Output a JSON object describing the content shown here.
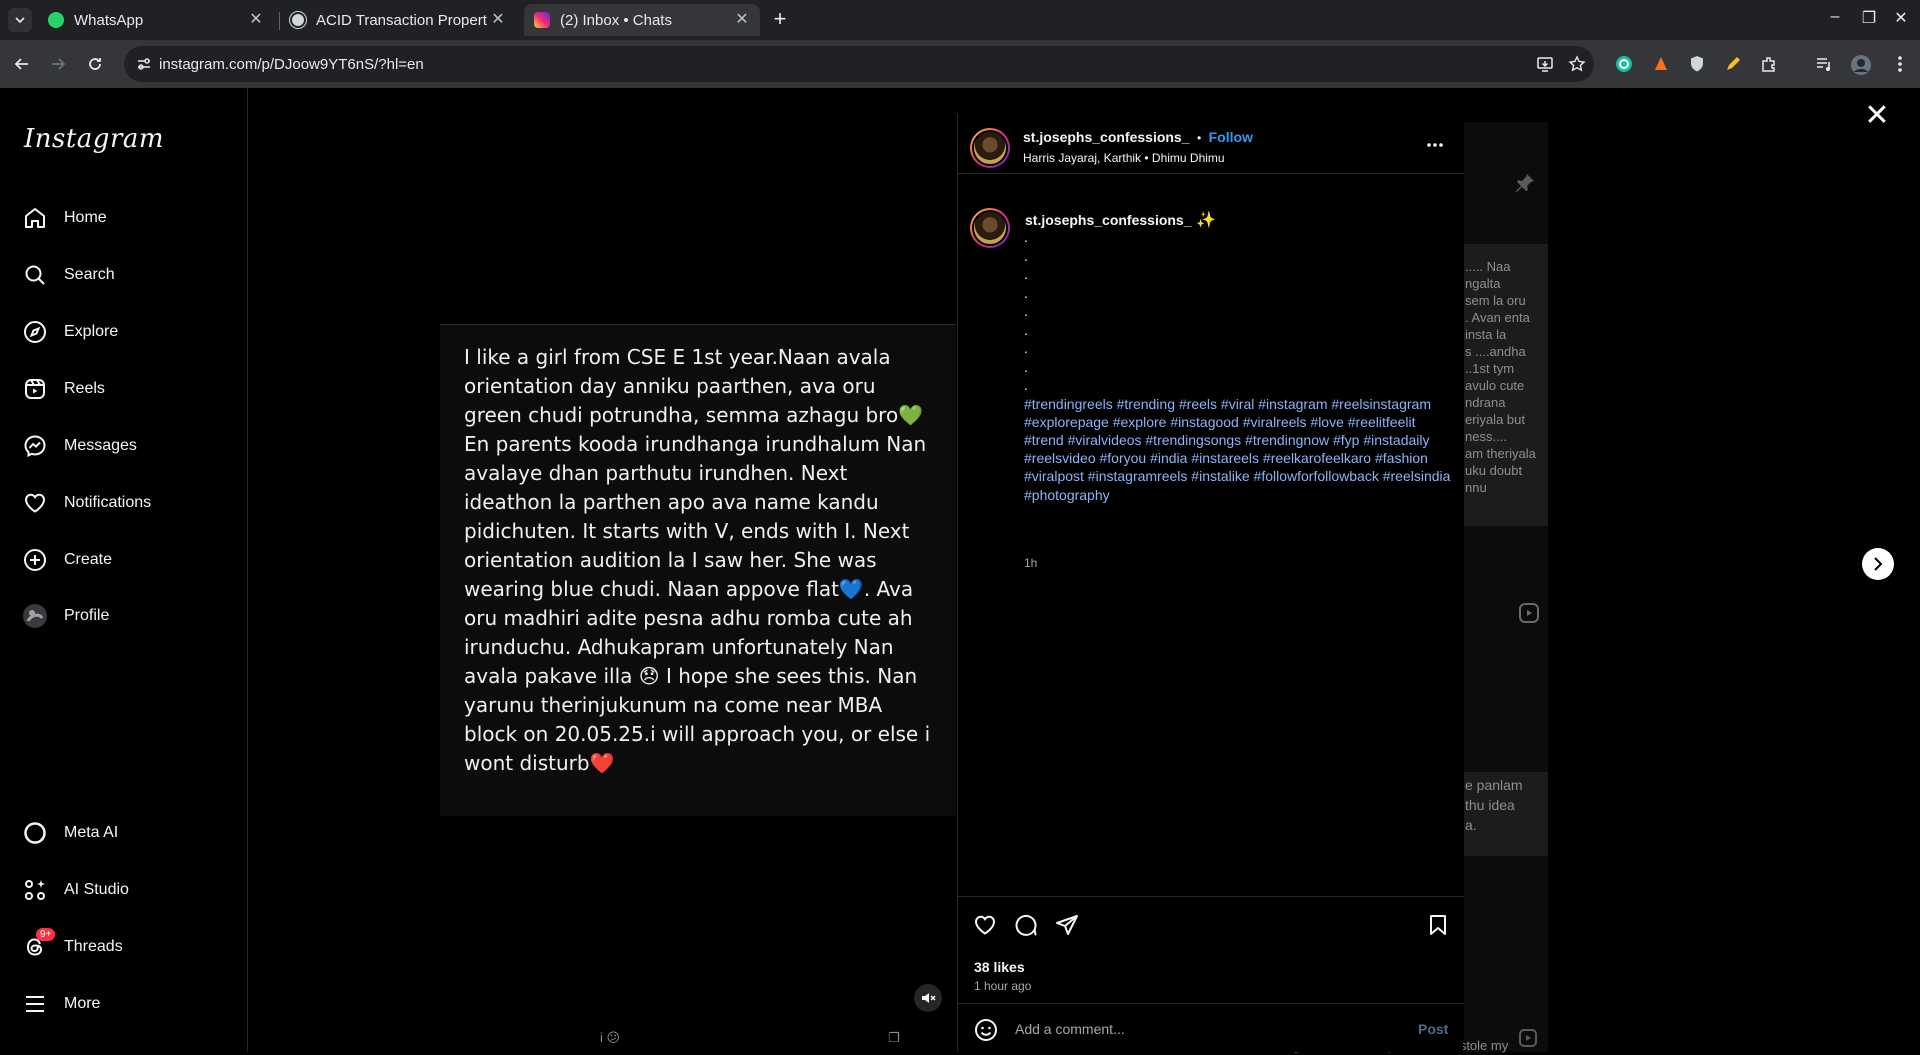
{
  "browser": {
    "tabs": [
      {
        "title": "WhatsApp",
        "favicon": "whatsapp-icon",
        "active": false
      },
      {
        "title": "ACID Transaction Propert",
        "favicon": "chatgpt-icon",
        "active": false
      },
      {
        "title": "(2) Inbox • Chats",
        "favicon": "instagram-icon",
        "active": true
      }
    ],
    "url": "instagram.com/p/DJoow9YT6nS/?hl=en"
  },
  "sidebar": {
    "logo": "Instagram",
    "items": [
      {
        "label": "Home",
        "icon": "home-icon"
      },
      {
        "label": "Search",
        "icon": "search-icon"
      },
      {
        "label": "Explore",
        "icon": "explore-icon"
      },
      {
        "label": "Reels",
        "icon": "reels-icon"
      },
      {
        "label": "Messages",
        "icon": "messenger-icon"
      },
      {
        "label": "Notifications",
        "icon": "heart-icon"
      },
      {
        "label": "Create",
        "icon": "plus-square-icon"
      },
      {
        "label": "Profile",
        "icon": "profile-avatar"
      }
    ],
    "bottom_items": [
      {
        "label": "Meta AI",
        "icon": "meta-ai-icon"
      },
      {
        "label": "AI Studio",
        "icon": "ai-studio-icon"
      },
      {
        "label": "Threads",
        "icon": "threads-icon",
        "badge": "9+"
      },
      {
        "label": "More",
        "icon": "hamburger-icon"
      }
    ]
  },
  "post": {
    "media_text": "I like a girl from CSE E 1st year.Naan avala orientation day anniku paarthen, ava oru green chudi potrundha, semma azhagu bro💚En parents kooda irundhanga irundhalum Nan avalaye dhan parthutu irundhen. Next ideathon la parthen apo ava name kandu pidichuten. It starts with V, ends with I. Next orientation audition la I saw her. She was wearing blue chudi. Naan appove flat💙. Ava oru madhiri adite pesna adhu romba cute ah irunduchu. Adhukapram unfortunately Nan avala pakave illa 😞 I hope she sees this. Nan yarunu therinjukunum na come near MBA block on 20.05.25.i will approach you, or else i wont disturb❤️",
    "header": {
      "username": "st.josephs_confessions_",
      "separator": "•",
      "follow": "Follow",
      "audio": "Harris Jayaraj, Karthik • Dhimu Dhimu"
    },
    "caption": {
      "username": "st.josephs_confessions_",
      "emoji": "✨",
      "dots": [
        ".",
        ".",
        ".",
        ".",
        ".",
        ".",
        ".",
        ".",
        ".",
        "."
      ],
      "hashtags": "#trendingreels #trending #reels #viral #instagram #reelsinstagram #explorepage #explore #instagood #viralreels #love #reelitfeelit #trend #viralvideos #trendingsongs #trendingnow #fyp #instadaily #reelsvideo #foryou #india #instareels #reelkarofeelkaro #fashion #viralpost #instagramreels #instalike #followforfollowback #reelsindia #photography",
      "time": "1h"
    },
    "likes": "38 likes",
    "time_ago": "1 hour ago",
    "comment_placeholder": "Add a comment...",
    "post_button": "Post"
  },
  "background": {
    "right_snippet_1": [
      "..... Naa",
      "ngalta",
      "sem la oru",
      ". Avan enta",
      "insta la",
      "s ....andha",
      "..1st tym",
      "avulo cute",
      "ndrana",
      "eriyala but",
      "ness....",
      "am theriyala",
      "uku doubt",
      "nnu"
    ],
    "right_snippet_2": [
      "e panlam",
      "thu idea",
      "a."
    ],
    "bottom_snippet": "I saw a girl from EEE dept 😳👀 she stole my",
    "bottom_emoji": "i 😕"
  },
  "colors": {
    "accent": "#3897f0",
    "hashtag": "#8ab4f8",
    "badge": "#ff3040"
  }
}
